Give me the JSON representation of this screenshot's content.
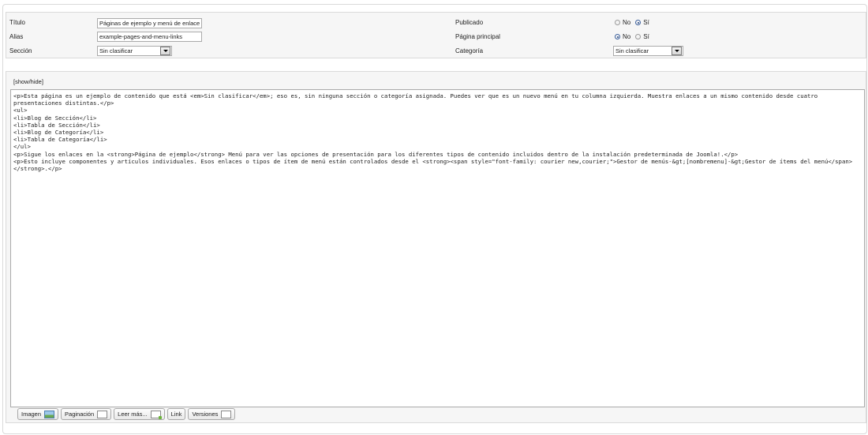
{
  "details": {
    "titulo_label": "Título",
    "titulo_value": "Páginas de ejemplo y menú de enlace",
    "alias_label": "Alias",
    "alias_value": "example-pages-and-menu-links",
    "seccion_label": "Sección",
    "seccion_value": "Sin clasificar",
    "publicado_label": "Publicado",
    "pagina_principal_label": "Página principal",
    "categoria_label": "Categoría",
    "categoria_value": "Sin clasificar",
    "no_label": "No",
    "si_label": "Sí",
    "publicado_selected": "Sí",
    "pagina_principal_selected": "No"
  },
  "editor": {
    "toggle_label": "[show/hide]",
    "content": "<p>Esta página es un ejemplo de contenido que está <em>Sin clasificar</em>; eso es, sin ninguna sección o categoría asignada. Puedes ver que es un nuevo menú en tu columna izquierda. Muestra enlaces a un mismo contenido desde cuatro presentaciones distintas.</p>\n<ul>\n<li>Blog de Sección</li>\n<li>Tabla de Sección</li>\n<li>Blog de Categoría</li>\n<li>Tabla de Categoría</li>\n</ul>\n<p>Sigue los enlaces en la <strong>Página de ejemplo</strong> Menú para ver las opciones de presentación para los diferentes tipos de contenido incluidos dentro de la instalación predeterminada de Joomla!.</p>\n<p>Esto incluye componentes y artículos individuales. Esos enlaces o tipos de ítem de menú están controlados desde el <strong><span style=\"font-family: courier new,courier;\">Gestor de menús-&gt;[nombremenu]-&gt;Gestor de ítems del menú</span></strong>.</p>"
  },
  "buttons": {
    "imagen": "Imagen",
    "paginacion": "Paginación",
    "leer_mas": "Leer más...",
    "link": "Link",
    "versiones": "Versiones"
  }
}
